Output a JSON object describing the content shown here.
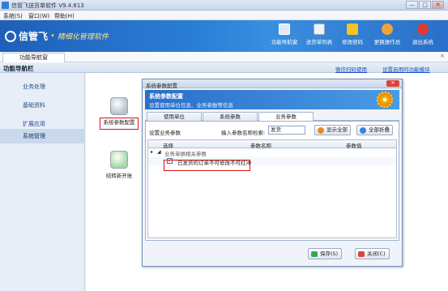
{
  "window": {
    "title": "信管飞送货单软件 V9.4.613",
    "min": "—",
    "max": "□",
    "close": "✕"
  },
  "menu": [
    "系统(S)",
    "窗口(W)",
    "帮助(H)"
  ],
  "brand": {
    "name": "信管飞",
    "dot": "•",
    "slogan": "精细化管理软件"
  },
  "toolbar": [
    {
      "label": "功能导航窗",
      "icon": "monitor-icon",
      "color": "#dfe9f6"
    },
    {
      "label": "送货单列表",
      "icon": "list-icon",
      "color": "#eef3fa"
    },
    {
      "label": "修改密码",
      "icon": "lock-icon",
      "color": "#f3c423"
    },
    {
      "label": "更换操作员",
      "icon": "user-icon",
      "color": "#f0a33a"
    },
    {
      "label": "退出系统",
      "icon": "exit-icon",
      "color": "#e03a2f"
    }
  ],
  "tabs": {
    "main": "功能导航窗",
    "close": "×"
  },
  "navbar": {
    "title": "功能导航栏",
    "link1": "微信扫码使用",
    "link2": "设置启用的功能模块"
  },
  "sidebar": [
    "业务处理",
    "基础资料",
    "扩展应用",
    "系统管理"
  ],
  "content": {
    "icon1": "系统参数配置",
    "icon2": "结转新开账"
  },
  "dialog": {
    "title": "系统参数配置",
    "close": "✕",
    "head_title": "系统参数配置",
    "head_sub": "设置使用单位信息、业务参数等信息",
    "tabs": [
      "使用单位",
      "系统参数",
      "业务参数"
    ],
    "panel_label": "设置业务参数",
    "search_label": "输入参数名称检索:",
    "search_value": "发货",
    "btn_show_all": "显示全部",
    "btn_collapse": "全部折叠",
    "grid_cols": [
      "选择",
      "参数名称",
      "参数值"
    ],
    "group_row": "业务单据相关参数",
    "group_arrow": "▸",
    "group_expand": "◢",
    "item_row": "已发货的订单不可修改不可红冲",
    "item_check": "✓",
    "save": "保存(S)",
    "close_btn": "关闭(C)"
  }
}
